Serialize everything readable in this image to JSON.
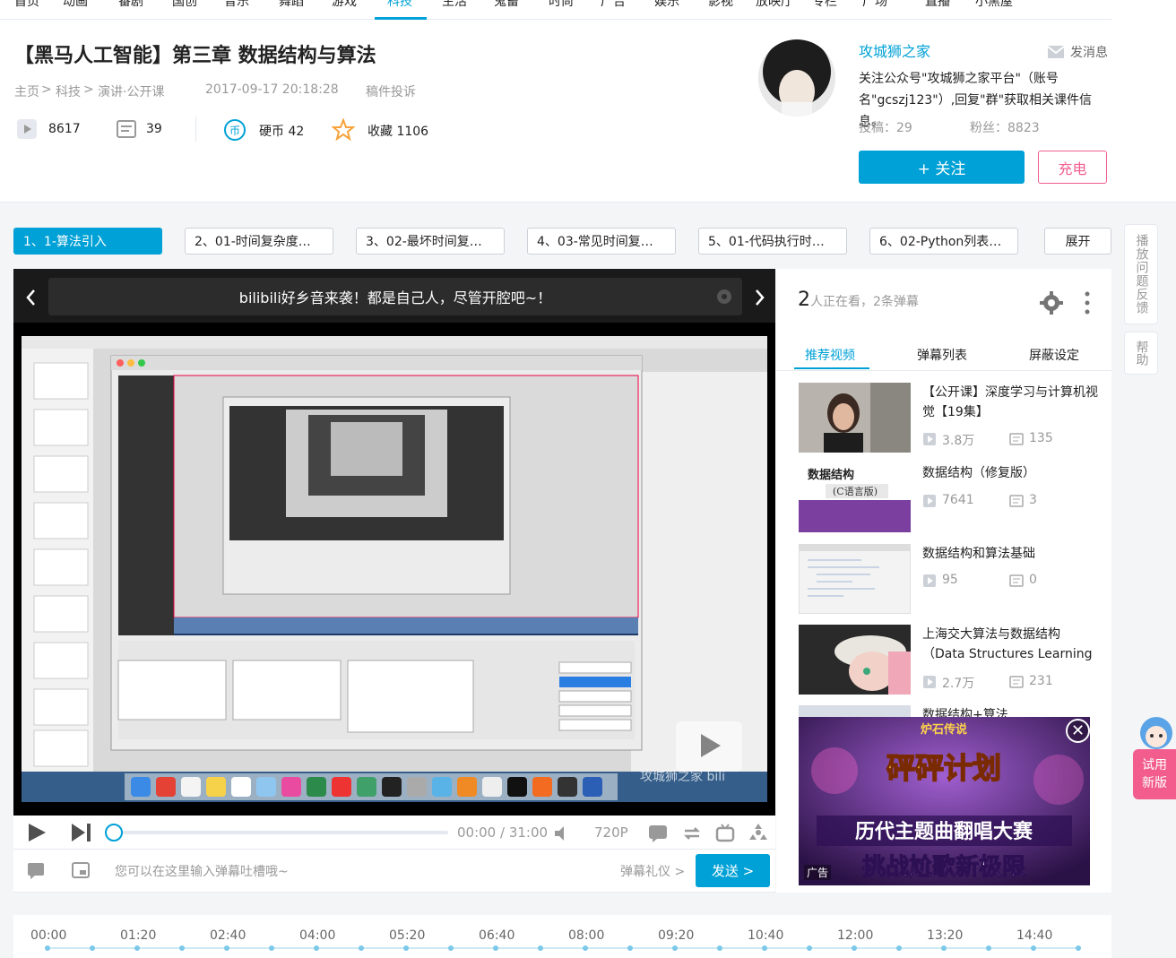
{
  "nav": {
    "items": [
      "首页",
      "动画",
      "番剧",
      "国创",
      "音乐",
      "舞蹈",
      "游戏",
      "科技",
      "生活",
      "鬼畜",
      "时尚",
      "广告",
      "娱乐",
      "影视",
      "放映厅",
      "专栏",
      "广场",
      "直播",
      "小黑屋"
    ],
    "active_index": 7
  },
  "video": {
    "title": "【黑马人工智能】第三章 数据结构与算法",
    "breadcrumb": [
      "主页",
      "科技",
      "演讲·公开课"
    ],
    "date": "2017-09-17 20:18:28",
    "report": "稿件投诉",
    "plays": "8617",
    "danmaku_count": "39",
    "coins_label": "硬币 42",
    "favorites_label": "收藏 1106"
  },
  "up": {
    "name": "攻城狮之家",
    "message_label": "发消息",
    "description": "关注公众号\"攻城狮之家平台\"（账号名\"gcszj123\"）,回复\"群\"获取相关课件信息。",
    "posts": "投稿：29",
    "fans": "粉丝：8823",
    "follow_label": "+ 关注",
    "charge_label": "充电"
  },
  "parts": [
    "1、1-算法引入",
    "2、01-时间复杂度…",
    "3、02-最坏时间复…",
    "4、03-常见时间复…",
    "5、01-代码执行时…",
    "6、02-Python列表…"
  ],
  "expand_label": "展开",
  "side_tabs": [
    "播放问题反馈",
    "帮助"
  ],
  "player": {
    "notice": "bilibili好乡音来袭！都是自己人，尽管开腔吧~！",
    "time_current": "00:00",
    "time_total": "31:00",
    "quality": "720P",
    "danmaku_placeholder": "您可以在这里输入弹幕吐槽哦~",
    "etiquette": "弹幕礼仪 >",
    "send_label": "发送 >",
    "progress_fraction": 0,
    "watermark": "攻城狮之家 bili"
  },
  "right": {
    "viewers_num": "2",
    "viewers_text": "人正在看，2条弹幕",
    "tabs": [
      "推荐视频",
      "弹幕列表",
      "屏蔽设定"
    ],
    "recommendations": [
      {
        "title": "【公开课】深度学习与计算机视觉【19集】",
        "plays": "3.8万",
        "danmaku": "135"
      },
      {
        "title": "数据结构（修复版）",
        "plays": "7641",
        "danmaku": "3"
      },
      {
        "title": "数据结构和算法基础",
        "plays": "95",
        "danmaku": "0"
      },
      {
        "title": "上海交大算法与数据结构（Data Structures Learning",
        "plays": "2.7万",
        "danmaku": "231"
      },
      {
        "title": "数据结构+算法",
        "plays": "",
        "danmaku": ""
      }
    ],
    "thumb2_text_a": "数据结构",
    "thumb2_text_b": "(C语言版)",
    "ad": {
      "logo": "炉石传说",
      "headline": "砰砰计划",
      "line1": "历代主题曲翻唱大赛",
      "line2": "挑战尬歌新极限",
      "tag": "广告"
    },
    "trial_label": [
      "试用",
      "新版"
    ]
  },
  "timeline": [
    "00:00",
    "01:20",
    "02:40",
    "04:00",
    "05:20",
    "06:40",
    "08:00",
    "09:20",
    "10:40",
    "12:00",
    "13:20",
    "14:40"
  ],
  "colors": {
    "accent": "#00a1d6",
    "pink": "#f25d8e",
    "bg": "#f4f5f7"
  }
}
